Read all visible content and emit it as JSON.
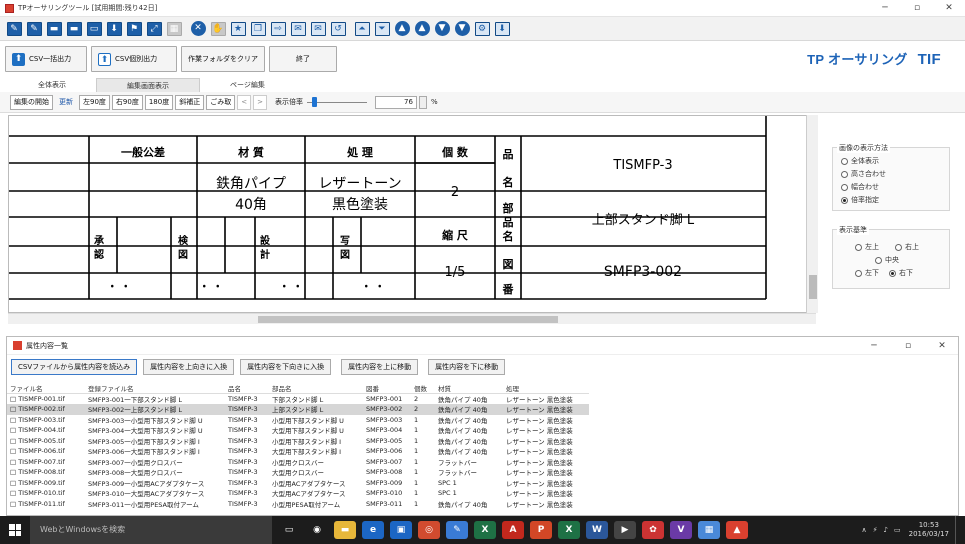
{
  "window": {
    "title": "TPオーサリングツール [試用期間:残り42日]"
  },
  "actions": {
    "csv_all": "CSV一括出力",
    "csv_individual": "CSV個別出力",
    "clear_folder": "作業フォルダをクリア",
    "end": "終了"
  },
  "brand": {
    "name": "TP オーサリング",
    "suffix": "TIF"
  },
  "tabs": [
    "全体表示",
    "編集画面表示",
    "ページ編集"
  ],
  "viewbar": {
    "edit_start": "編集の開始",
    "update": "更新",
    "rotate_left": "左90度",
    "rotate_right": "右90度",
    "rotate_180": "180度",
    "skew": "斜補正",
    "dust": "ごみ取",
    "prev": "<",
    "next": ">",
    "zoom_label": "表示倍率",
    "zoom_value": "76",
    "zoom_unit": "%",
    "zoom_fraction": 0.1
  },
  "drawing": {
    "tolerance": "一般公差",
    "material_h": "材 質",
    "process_h": "処 理",
    "qty_h": "個 数",
    "hin": "品",
    "mei": "名",
    "material_v": "鉄角パイプ\n40角",
    "process_v": "レザートーン\n黒色塗装",
    "qty_v": "2",
    "part_no_h": "TISMFP-3",
    "buhin": "部\n品\n名",
    "part_name": "上部スタンド脚 L",
    "scale_h": "縮 尺",
    "scale_v": "1/5",
    "approve": "承\n認",
    "inspect": "検\n図",
    "design": "設\n計",
    "copy": "写\n図",
    "zu": "図",
    "ban": "番",
    "drawing_no": "SMFP3-002",
    "dots": "・ ・"
  },
  "side": {
    "display_group": "画像の表示方法",
    "display_options": [
      "全体表示",
      "高さ合わせ",
      "幅合わせ",
      "倍率指定"
    ],
    "display_selected": 3,
    "anchor_group": "表示基準",
    "anchor_tl": "左上",
    "anchor_tr": "右上",
    "anchor_c": "中央",
    "anchor_bl": "左下",
    "anchor_br": "右下"
  },
  "sub": {
    "title": "属性内容一覧",
    "buttons": [
      "CSVファイルから属性内容を読込み",
      "属性内容を上向きに入換",
      "属性内容を下向きに入換",
      "属性内容を上に移動",
      "属性内容を下に移動"
    ],
    "columns": [
      "ファイル名",
      "登録ファイル名",
      "品名",
      "部品名",
      "図番",
      "個数",
      "材質",
      "処理"
    ],
    "rows": [
      [
        "□ TISMFP-001.tif",
        "SMFP3-001一下部スタンド脚 L",
        "TISMFP-3",
        "下部スタンド脚 L",
        "SMFP3-001",
        "2",
        "鉄角パイプ 40角",
        "レザートーン 黒色塗装"
      ],
      [
        "□ TISMFP-002.tif",
        "SMFP3-002一上部スタンド脚 L",
        "TISMFP-3",
        "上部スタンド脚 L",
        "SMFP3-002",
        "2",
        "鉄角パイプ 40角",
        "レザートーン 黒色塗装"
      ],
      [
        "□ TISMFP-003.tif",
        "SMFP3-003一小型用下部スタンド脚 U",
        "TISMFP-3",
        "小型用下部スタンド脚 U",
        "SMFP3-003",
        "1",
        "鉄角パイプ 40角",
        "レザートーン 黒色塗装"
      ],
      [
        "□ TISMFP-004.tif",
        "SMFP3-004一大型用下部スタンド脚 U",
        "TISMFP-3",
        "大型用下部スタンド脚 U",
        "SMFP3-004",
        "1",
        "鉄角パイプ 40角",
        "レザートーン 黒色塗装"
      ],
      [
        "□ TISMFP-005.tif",
        "SMFP3-005一小型用下部スタンド脚 I",
        "TISMFP-3",
        "小型用下部スタンド脚 I",
        "SMFP3-005",
        "1",
        "鉄角パイプ 40角",
        "レザートーン 黒色塗装"
      ],
      [
        "□ TISMFP-006.tif",
        "SMFP3-006一大型用下部スタンド脚 I",
        "TISMFP-3",
        "大型用下部スタンド脚 I",
        "SMFP3-006",
        "1",
        "鉄角パイプ 40角",
        "レザートーン 黒色塗装"
      ],
      [
        "□ TISMFP-007.tif",
        "SMFP3-007一小型用クロスバー",
        "TISMFP-3",
        "小型用クロスバー",
        "SMFP3-007",
        "1",
        "フラットバー",
        "レザートーン 黒色塗装"
      ],
      [
        "□ TISMFP-008.tif",
        "SMFP3-008一大型用クロスバー",
        "TISMFP-3",
        "大型用クロスバー",
        "SMFP3-008",
        "1",
        "フラットバー",
        "レザートーン 黒色塗装"
      ],
      [
        "□ TISMFP-009.tif",
        "SMFP3-009一小型用ACアダプタケース",
        "TISMFP-3",
        "小型用ACアダプタケース",
        "SMFP3-009",
        "1",
        "SPC 1",
        "レザートーン 黒色塗装"
      ],
      [
        "□ TISMFP-010.tif",
        "SMFP3-010一大型用ACアダプタケース",
        "TISMFP-3",
        "大型用ACアダプタケース",
        "SMFP3-010",
        "1",
        "SPC 1",
        "レザートーン 黒色塗装"
      ],
      [
        "□ TISMFP-011.tif",
        "SMFP3-011一小型用PESA取付アーム",
        "TISMFP-3",
        "小型用PESA取付アーム",
        "SMFP3-011",
        "1",
        "鉄角パイプ 40角",
        "レザートーン 黒色塗装"
      ]
    ],
    "selected_row": 1
  },
  "taskbar": {
    "search": "WebとWindowsを検索",
    "time": "10:53",
    "date": "2016/03/17",
    "apps": [
      {
        "name": "task-view-icon",
        "glyph": "▭",
        "color": "#1c1c1c"
      },
      {
        "name": "chrome-icon",
        "glyph": "◉",
        "color": "#1c1c1c"
      },
      {
        "name": "explorer-icon",
        "glyph": "▬",
        "color": "#e7b73a"
      },
      {
        "name": "edge-icon",
        "glyph": "e",
        "color": "#1c66c4"
      },
      {
        "name": "store-icon",
        "glyph": "▣",
        "color": "#1c66c4"
      },
      {
        "name": "chrome2-icon",
        "glyph": "◎",
        "color": "#d14b2f"
      },
      {
        "name": "paint-icon",
        "glyph": "✎",
        "color": "#3a7bd5"
      },
      {
        "name": "excel-icon",
        "glyph": "X",
        "color": "#1e7145"
      },
      {
        "name": "acrobat-icon",
        "glyph": "A",
        "color": "#c2281d"
      },
      {
        "name": "powerpoint-icon",
        "glyph": "P",
        "color": "#d24726"
      },
      {
        "name": "excel2-icon",
        "glyph": "X",
        "color": "#1e7145"
      },
      {
        "name": "word-icon",
        "glyph": "W",
        "color": "#2b579a"
      },
      {
        "name": "media-icon",
        "glyph": "▶",
        "color": "#444"
      },
      {
        "name": "app-icon",
        "glyph": "✿",
        "color": "#c33"
      },
      {
        "name": "vs-icon",
        "glyph": "V",
        "color": "#6a3aa6"
      },
      {
        "name": "grid-icon",
        "glyph": "▦",
        "color": "#4a89d8"
      },
      {
        "name": "tp-icon",
        "glyph": "▲",
        "color": "#d9402f"
      }
    ]
  },
  "toolbar_icons": [
    {
      "name": "new-icon",
      "glyph": "✎",
      "kind": "sq"
    },
    {
      "name": "edit-icon",
      "glyph": "✎",
      "kind": "sq"
    },
    {
      "name": "folder-open-icon",
      "glyph": "▬",
      "kind": "sq"
    },
    {
      "name": "folder-icon",
      "glyph": "▬",
      "kind": "sq"
    },
    {
      "name": "monitor-icon",
      "glyph": "▭",
      "kind": "sq"
    },
    {
      "name": "download-icon",
      "glyph": "⬇",
      "kind": "sq"
    },
    {
      "name": "filter-icon",
      "glyph": "⚑",
      "kind": "sq"
    },
    {
      "name": "resize-icon",
      "glyph": "⤢",
      "kind": "sq"
    },
    {
      "name": "disabled-icon",
      "glyph": "▦",
      "kind": "grey"
    },
    {
      "name": "close-circle-icon",
      "glyph": "✕",
      "kind": "circ"
    },
    {
      "name": "stamp-icon",
      "glyph": "✋",
      "kind": "grey"
    },
    {
      "name": "star-icon",
      "glyph": "★",
      "kind": "light"
    },
    {
      "name": "copy-icon",
      "glyph": "❐",
      "kind": "light"
    },
    {
      "name": "export-icon",
      "glyph": "⇨",
      "kind": "light"
    },
    {
      "name": "comment-icon",
      "glyph": "✉",
      "kind": "light"
    },
    {
      "name": "comment2-icon",
      "glyph": "✉",
      "kind": "light"
    },
    {
      "name": "undo-icon",
      "glyph": "↺",
      "kind": "light"
    },
    {
      "name": "up-icon",
      "glyph": "⏶",
      "kind": "light"
    },
    {
      "name": "down-icon",
      "glyph": "⏷",
      "kind": "light"
    },
    {
      "name": "circle-up-icon",
      "glyph": "▲",
      "kind": "circ"
    },
    {
      "name": "circle-up2-icon",
      "glyph": "▲",
      "kind": "circ"
    },
    {
      "name": "circle-down-icon",
      "glyph": "▼",
      "kind": "circ"
    },
    {
      "name": "circle-down2-icon",
      "glyph": "▼",
      "kind": "circ"
    },
    {
      "name": "settings-icon",
      "glyph": "⚙",
      "kind": "light"
    },
    {
      "name": "save-icon",
      "glyph": "⬇",
      "kind": "light"
    }
  ]
}
